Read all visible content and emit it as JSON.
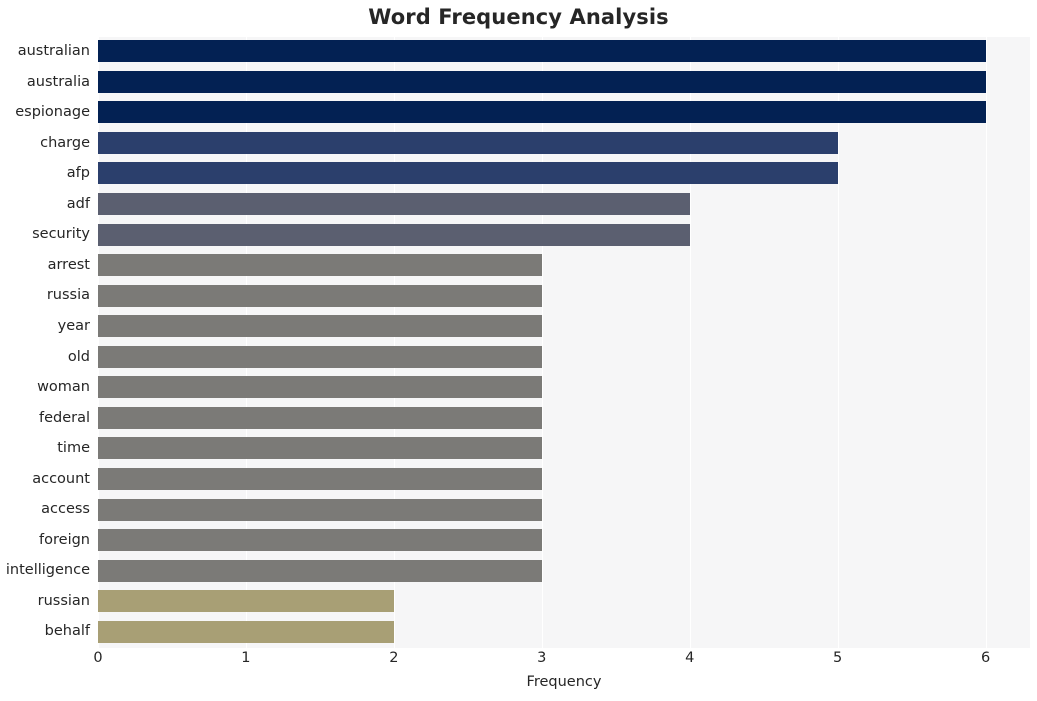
{
  "chart_data": {
    "type": "bar",
    "orientation": "horizontal",
    "title": "Word Frequency Analysis",
    "xlabel": "Frequency",
    "ylabel": "",
    "xlim": [
      0,
      6.3
    ],
    "xticks": [
      0,
      1,
      2,
      3,
      4,
      5,
      6
    ],
    "xtick_labels": [
      "0",
      "1",
      "2",
      "3",
      "4",
      "5",
      "6"
    ],
    "grid": true,
    "grid_axis": "x",
    "legend": "none",
    "categories": [
      "australian",
      "australia",
      "espionage",
      "charge",
      "afp",
      "adf",
      "security",
      "arrest",
      "russia",
      "year",
      "old",
      "woman",
      "federal",
      "time",
      "account",
      "access",
      "foreign",
      "intelligence",
      "russian",
      "behalf"
    ],
    "values": [
      6,
      6,
      6,
      5,
      5,
      4,
      4,
      3,
      3,
      3,
      3,
      3,
      3,
      3,
      3,
      3,
      3,
      3,
      2,
      2
    ],
    "bar_colors": [
      "#032153",
      "#032153",
      "#032153",
      "#2b3f6c",
      "#2b3f6c",
      "#5b5f70",
      "#5b5f70",
      "#7b7a77",
      "#7b7a77",
      "#7b7a77",
      "#7b7a77",
      "#7b7a77",
      "#7b7a77",
      "#7b7a77",
      "#7b7a77",
      "#7b7a77",
      "#7b7a77",
      "#7b7a77",
      "#a89f75",
      "#a89f75"
    ]
  },
  "style": {
    "plot_background": "#f6f6f7",
    "figure_background": "#ffffff",
    "gridline_color": "#ffffff",
    "text_color": "#262626"
  }
}
